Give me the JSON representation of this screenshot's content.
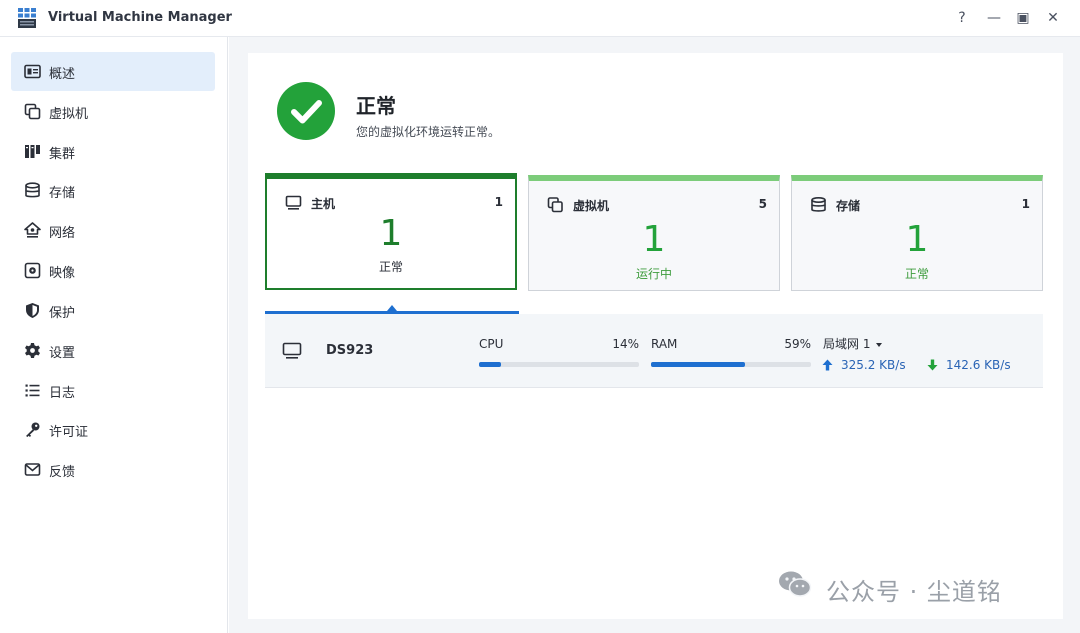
{
  "window": {
    "title": "Virtual Machine Manager",
    "help_label": "?",
    "minimize_label": "—",
    "maximize_label": "▣",
    "close_label": "✕"
  },
  "sidebar": {
    "items": [
      {
        "label": "概述",
        "icon": "overview-icon",
        "active": true
      },
      {
        "label": "虚拟机",
        "icon": "virtual-machine-icon"
      },
      {
        "label": "集群",
        "icon": "cluster-icon"
      },
      {
        "label": "存储",
        "icon": "storage-icon"
      },
      {
        "label": "网络",
        "icon": "network-icon"
      },
      {
        "label": "映像",
        "icon": "image-icon"
      },
      {
        "label": "保护",
        "icon": "shield-icon"
      },
      {
        "label": "设置",
        "icon": "gear-icon"
      },
      {
        "label": "日志",
        "icon": "log-list-icon"
      },
      {
        "label": "许可证",
        "icon": "key-icon"
      },
      {
        "label": "反馈",
        "icon": "mail-icon"
      }
    ]
  },
  "status": {
    "title": "正常",
    "description": "您的虚拟化环境运转正常。",
    "icon": "check-circle-icon",
    "color": "#23a23a"
  },
  "cards": [
    {
      "title": "主机",
      "count": "1",
      "value": "1",
      "status": "正常",
      "icon": "monitor-icon",
      "selected": true
    },
    {
      "title": "虚拟机",
      "count": "5",
      "value": "1",
      "status": "运行中",
      "icon": "virtual-machine-icon"
    },
    {
      "title": "存储",
      "count": "1",
      "value": "1",
      "status": "正常",
      "icon": "storage-icon"
    }
  ],
  "host": {
    "name": "DS923",
    "cpu_label": "CPU",
    "cpu_pct": "14%",
    "cpu_value": 0.14,
    "ram_label": "RAM",
    "ram_pct": "59%",
    "ram_value": 0.59,
    "network_label": "局域网 1",
    "upload": "325.2 KB/s",
    "download": "142.6 KB/s",
    "accent": "#1e6fd0",
    "upload_color": "#1e6fd0",
    "download_color": "#23a23a"
  },
  "watermark": {
    "text": "公众号 · 尘道铭"
  }
}
